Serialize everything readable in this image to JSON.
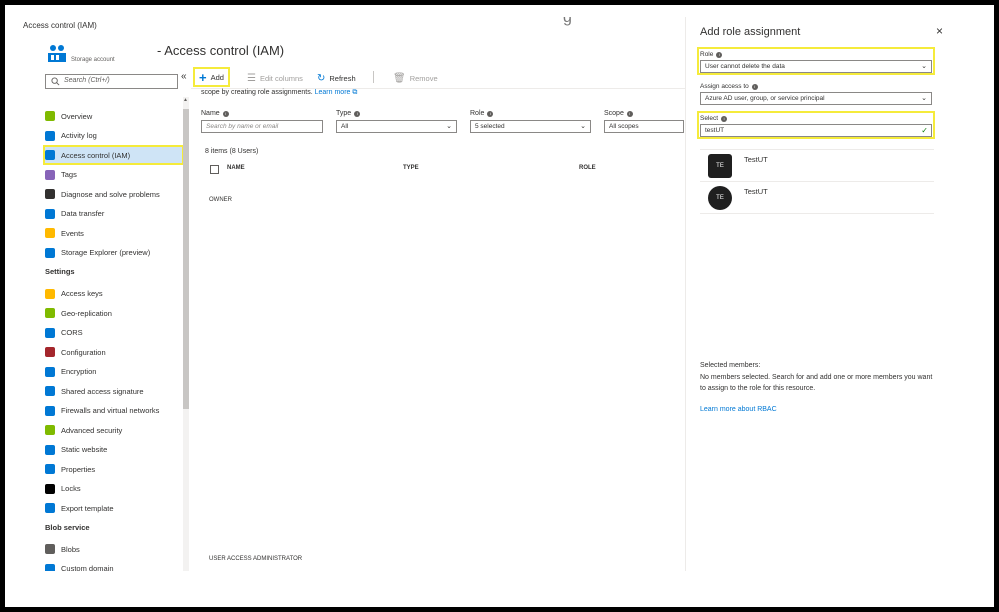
{
  "window": {
    "title": "Access control (IAM)",
    "extra": "g"
  },
  "resource": {
    "type_label": "Storage account",
    "page_title": "- Access control (IAM)"
  },
  "sidebar": {
    "search_placeholder": "Search (Ctrl+/)",
    "collapse": "«",
    "items": [
      {
        "label": "Overview",
        "icon": "overview-icon",
        "color": "#7fba00"
      },
      {
        "label": "Activity log",
        "icon": "activity-log-icon",
        "color": "#0078d4"
      },
      {
        "label": "Access control (IAM)",
        "icon": "iam-icon",
        "color": "#0078d4",
        "active": true
      },
      {
        "label": "Tags",
        "icon": "tag-icon",
        "color": "#8764b8"
      },
      {
        "label": "Diagnose and solve problems",
        "icon": "wrench-icon",
        "color": "#323130"
      },
      {
        "label": "Data transfer",
        "icon": "data-transfer-icon",
        "color": "#0078d4"
      },
      {
        "label": "Events",
        "icon": "lightning-icon",
        "color": "#ffb900"
      },
      {
        "label": "Storage Explorer (preview)",
        "icon": "storage-explorer-icon",
        "color": "#0078d4"
      }
    ],
    "settings_header": "Settings",
    "settings_items": [
      {
        "label": "Access keys",
        "icon": "key-icon",
        "color": "#ffb900"
      },
      {
        "label": "Geo-replication",
        "icon": "globe-icon",
        "color": "#7fba00"
      },
      {
        "label": "CORS",
        "icon": "cors-icon",
        "color": "#0078d4"
      },
      {
        "label": "Configuration",
        "icon": "configuration-icon",
        "color": "#a4262c"
      },
      {
        "label": "Encryption",
        "icon": "lock-icon",
        "color": "#0078d4"
      },
      {
        "label": "Shared access signature",
        "icon": "link-icon",
        "color": "#0078d4"
      },
      {
        "label": "Firewalls and virtual networks",
        "icon": "firewall-icon",
        "color": "#0078d4"
      },
      {
        "label": "Advanced security",
        "icon": "shield-icon",
        "color": "#7fba00"
      },
      {
        "label": "Static website",
        "icon": "website-icon",
        "color": "#0078d4"
      },
      {
        "label": "Properties",
        "icon": "properties-icon",
        "color": "#0078d4"
      },
      {
        "label": "Locks",
        "icon": "padlock-icon",
        "color": "#000000"
      },
      {
        "label": "Export template",
        "icon": "export-icon",
        "color": "#0078d4"
      }
    ],
    "blob_header": "Blob service",
    "blob_items": [
      {
        "label": "Blobs",
        "icon": "blobs-icon",
        "color": "#605e5c"
      },
      {
        "label": "Custom domain",
        "icon": "custom-domain-icon",
        "color": "#0078d4"
      }
    ]
  },
  "toolbar": {
    "add": "Add",
    "edit_columns": "Edit columns",
    "refresh": "Refresh",
    "remove": "Remove"
  },
  "main": {
    "scope_text": "scope by creating role assignments.",
    "learn_more": "Learn more",
    "filters": {
      "name_label": "Name",
      "name_placeholder": "Search by name or email",
      "type_label": "Type",
      "type_value": "All",
      "role_label": "Role",
      "role_value": "5 selected",
      "scope_label": "Scope",
      "scope_value": "All scopes"
    },
    "items_count": "8 items (8 Users)",
    "columns": {
      "name": "NAME",
      "type": "TYPE",
      "role": "ROLE"
    },
    "group_owner": "OWNER",
    "group_uaa": "USER ACCESS ADMINISTRATOR"
  },
  "panel": {
    "title": "Add role assignment",
    "close": "×",
    "role_label": "Role",
    "role_value": "User cannot delete the data",
    "assign_label": "Assign access to",
    "assign_value": "Azure AD user, group, or service principal",
    "select_label": "Select",
    "select_value": "testUT",
    "results": [
      {
        "initials": "TE",
        "name": "TestUT"
      },
      {
        "initials": "TE",
        "name": "TestUT"
      }
    ],
    "selected_members_label": "Selected members:",
    "selected_members_desc": "No members selected. Search for and add one or more members you want to assign to the role for this resource.",
    "rbac_link": "Learn more about RBAC"
  },
  "colors": {
    "accent": "#0078d4",
    "highlight": "#f5eb3b",
    "active_bg": "#cfe4f6"
  }
}
